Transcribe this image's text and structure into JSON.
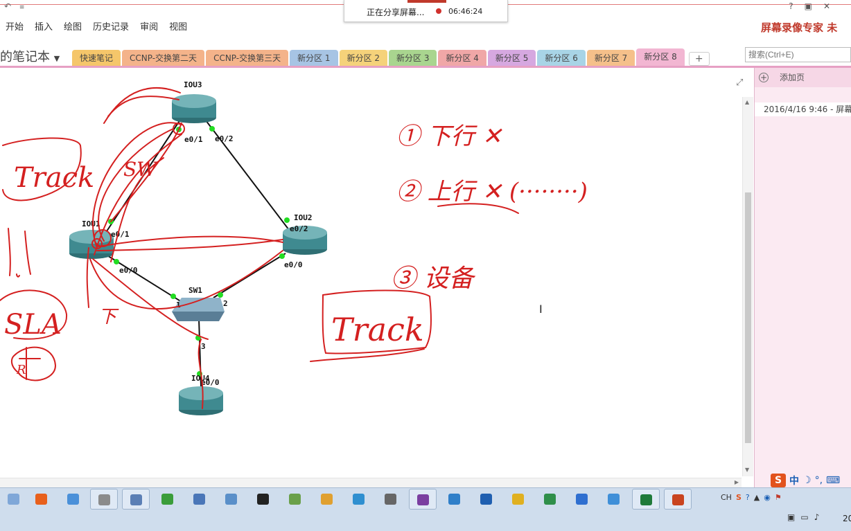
{
  "ribbon": {
    "menu": [
      "开始",
      "插入",
      "绘图",
      "历史记录",
      "审阅",
      "视图"
    ],
    "help": "?",
    "brand": "屏幕录像专家 未",
    "qat_icon": "undo-icon"
  },
  "share_bar": {
    "status": "正在分享屏幕...",
    "time": "06:46:24"
  },
  "notebook": {
    "title": "的笔记本",
    "dropdown_icon": "chevron-down-icon"
  },
  "sections": [
    {
      "label": "快速笔记",
      "color": "#f5c66a"
    },
    {
      "label": "CCNP-交换第二天",
      "color": "#f4b38a"
    },
    {
      "label": "CCNP-交换第三天",
      "color": "#f4b38a"
    },
    {
      "label": "新分区 1",
      "color": "#a7c4e4"
    },
    {
      "label": "新分区 2",
      "color": "#f5d27a"
    },
    {
      "label": "新分区 3",
      "color": "#a9d58f"
    },
    {
      "label": "新分区 4",
      "color": "#f0a7a7"
    },
    {
      "label": "新分区 5",
      "color": "#d6a8e0"
    },
    {
      "label": "新分区 6",
      "color": "#a8d4e6"
    },
    {
      "label": "新分区 7",
      "color": "#f5c08a"
    },
    {
      "label": "新分区 8",
      "color": "#f2b6d2"
    }
  ],
  "add_section": "+",
  "search": {
    "placeholder": "搜索(Ctrl+E)"
  },
  "pages": {
    "add_label": "添加页",
    "items": [
      "2016/4/16 9:46 - 屏幕"
    ]
  },
  "diagram": {
    "nodes": [
      {
        "name": "IOU3",
        "kind": "router"
      },
      {
        "name": "IOU1",
        "kind": "router"
      },
      {
        "name": "IOU2",
        "kind": "router"
      },
      {
        "name": "SW1",
        "kind": "switch"
      },
      {
        "name": "IOU4",
        "kind": "router"
      }
    ],
    "ports": [
      "e0/1",
      "e0/2",
      "e0/1",
      "e0/0",
      "e0/2",
      "e0/0",
      "1",
      "2",
      "3",
      "e0/0"
    ]
  },
  "handwriting": {
    "left": [
      "Track",
      "SW",
      "SLA",
      "R",
      "下"
    ],
    "right": [
      "① 下行 ✕",
      "② 上行 ✕ (········)",
      "③ 设备",
      "Track"
    ]
  },
  "ime": {
    "mode": "中"
  },
  "tray": {
    "lang": "CH"
  },
  "clock": "20"
}
